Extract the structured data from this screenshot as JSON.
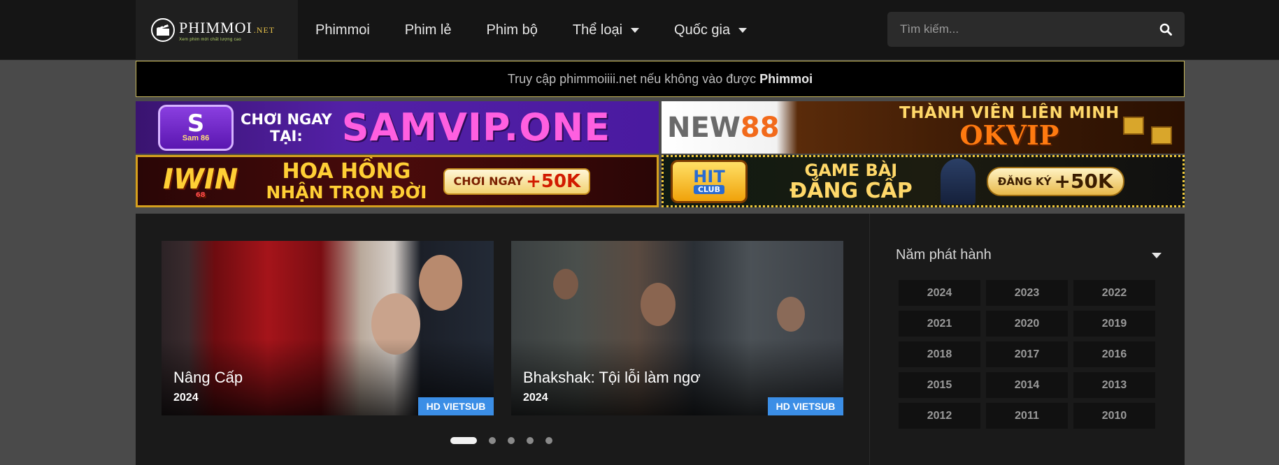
{
  "header": {
    "logo": {
      "name": "PHIMMOI",
      "suffix": ".NET",
      "tagline": "Xem phim mới chất lượng cao"
    },
    "nav": [
      {
        "label": "Phimmoi",
        "dropdown": false
      },
      {
        "label": "Phim lẻ",
        "dropdown": false
      },
      {
        "label": "Phim bộ",
        "dropdown": false
      },
      {
        "label": "Thể loại",
        "dropdown": true
      },
      {
        "label": "Quốc gia",
        "dropdown": true
      }
    ],
    "search": {
      "placeholder": "Tìm kiếm...",
      "icon": "search-icon"
    }
  },
  "notice": {
    "text": "Truy cập phimmoiiii.net nếu không vào được",
    "brand": "Phimmoi"
  },
  "banners": {
    "samvip": {
      "logo_top": "S",
      "logo_sub": "Sam 86",
      "cta_line1": "CHƠI NGAY",
      "cta_line2": "TẠI:",
      "domain": "SAMVIP.ONE"
    },
    "new88": {
      "brand_a": "NEW",
      "brand_b": "88",
      "line1": "THÀNH VIÊN LIÊN MINH",
      "line2": "OKVIP"
    },
    "iwin": {
      "brand": "IWIN",
      "brand_sub": "68",
      "line1": "HOA HỒNG",
      "line2": "NHẬN TRỌN ĐỜI",
      "cta": "CHƠI NGAY",
      "bonus": "+50K"
    },
    "hitclub": {
      "brand": "HIT",
      "brand_sub": "CLUB",
      "line1": "GAME BÀI",
      "line2": "ĐẲNG CẤP",
      "cta": "ĐĂNG KÝ",
      "bonus": "+50K"
    }
  },
  "slider": {
    "slides": [
      {
        "title": "Nâng Cấp",
        "year": "2024",
        "badge": "HD VIETSUB"
      },
      {
        "title": "Bhakshak: Tội lỗi làm ngơ",
        "year": "2024",
        "badge": "HD VIETSUB"
      }
    ],
    "dots": 5,
    "active_dot": 1
  },
  "sidebar": {
    "heading": "Năm phát hành",
    "years": [
      "2024",
      "2023",
      "2022",
      "2021",
      "2020",
      "2019",
      "2018",
      "2017",
      "2016",
      "2015",
      "2014",
      "2013",
      "2012",
      "2011",
      "2010"
    ]
  },
  "colors": {
    "accent_badge": "#3b8ee6",
    "notice_border": "#c8b85a",
    "header_bg": "#151515"
  }
}
